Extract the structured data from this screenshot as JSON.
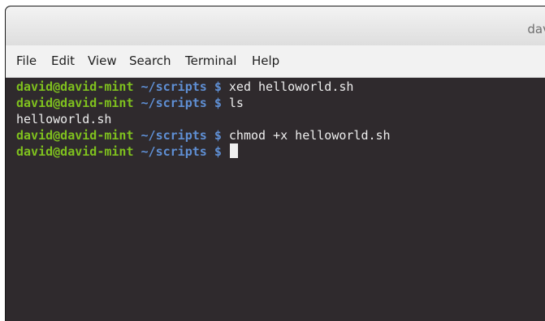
{
  "window": {
    "title": "dav"
  },
  "menu": {
    "items": [
      "File",
      "Edit",
      "View",
      "Search",
      "Terminal",
      "Help"
    ]
  },
  "terminal": {
    "lines": [
      {
        "user": "david@david-mint",
        "path": " ~/scripts $",
        "cmd": " xed helloworld.sh"
      },
      {
        "user": "david@david-mint",
        "path": " ~/scripts $",
        "cmd": " ls"
      },
      {
        "output": "helloworld.sh"
      },
      {
        "user": "david@david-mint",
        "path": " ~/scripts $",
        "cmd": " chmod +x helloworld.sh"
      },
      {
        "user": "david@david-mint",
        "path": " ~/scripts $",
        "cmd": " "
      }
    ]
  },
  "colors": {
    "prompt_user": "#7fc11e",
    "prompt_path": "#5f8fd4",
    "terminal_background": "#2f2a2d"
  }
}
